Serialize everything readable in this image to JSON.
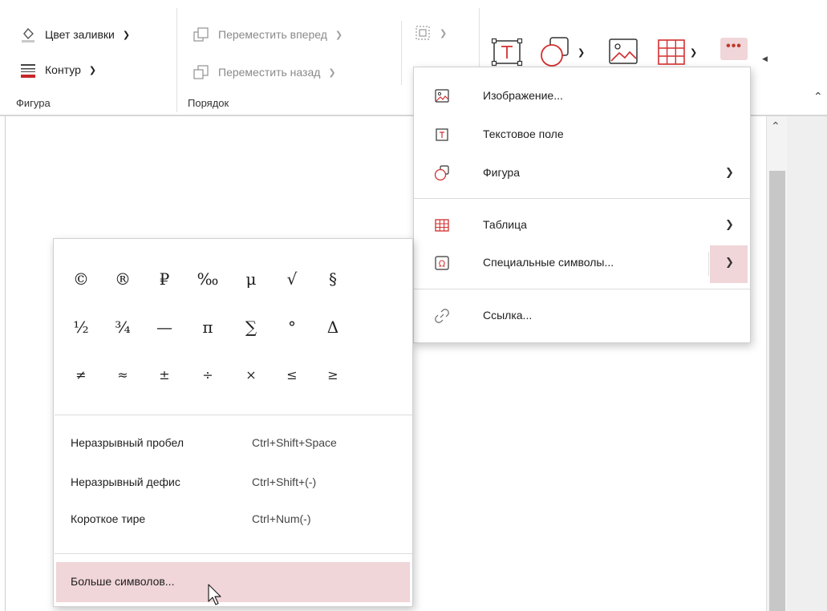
{
  "ribbon": {
    "shape_group": {
      "fill_label": "Цвет заливки",
      "outline_label": "Контур",
      "group_label": "Фигура"
    },
    "order_group": {
      "forward_label": "Переместить вперед",
      "backward_label": "Переместить назад",
      "group_label": "Порядок"
    },
    "buttons": [
      "text-box",
      "shape",
      "image",
      "table",
      "more"
    ],
    "more_label": "•••"
  },
  "insert_menu": {
    "items": [
      {
        "label": "Изображение...",
        "icon": "image-icon",
        "submenu": false
      },
      {
        "label": "Текстовое поле",
        "icon": "text-box-icon",
        "submenu": false
      },
      {
        "label": "Фигура",
        "icon": "shape-icon",
        "submenu": true
      },
      {
        "label": "Таблица",
        "icon": "table-icon",
        "submenu": true
      },
      {
        "label": "Специальные символы...",
        "icon": "omega-icon",
        "submenu": true,
        "highlighted": true
      },
      {
        "label": "Ссылка...",
        "icon": "link-icon",
        "submenu": false
      }
    ]
  },
  "symbols_panel": {
    "grid": [
      [
        "©",
        "®",
        "₽",
        "‰",
        "μ",
        "√",
        "§"
      ],
      [
        "½",
        "¾",
        "—",
        "π",
        "∑",
        "°",
        "Δ"
      ],
      [
        "≠",
        "≈",
        "±",
        "÷",
        "×",
        "≤",
        "≥"
      ]
    ],
    "shortcuts": [
      {
        "label": "Неразрывный пробел",
        "keys": "Ctrl+Shift+Space"
      },
      {
        "label": "Неразрывный дефис",
        "keys": "Ctrl+Shift+(-)"
      },
      {
        "label": "Короткое тире",
        "keys": "Ctrl+Num(-)"
      }
    ],
    "more_label": "Больше символов..."
  },
  "colors": {
    "accent": "#d32f2f",
    "highlight": "#f0d5d9",
    "text": "#1e1e1e",
    "disabled": "#8a8a8a"
  }
}
